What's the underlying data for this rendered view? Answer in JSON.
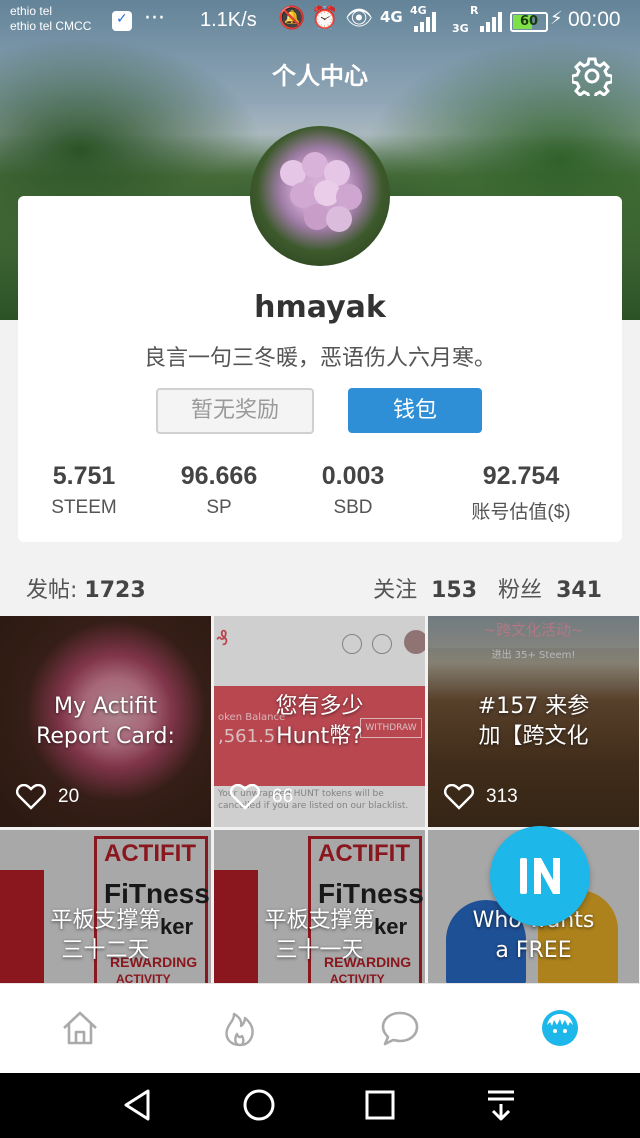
{
  "status_bar": {
    "carrier_line1": "ethio tel",
    "carrier_line2": "ethio tel CMCC",
    "more": "···",
    "speed": "1.1K/s",
    "net_4g": "4G",
    "net_4g_small": "4G",
    "net_r": "R",
    "net_3g": "3G",
    "battery": "60",
    "battery_level": 0.6,
    "time": "00:00"
  },
  "header": {
    "title": "个人中心",
    "settings_icon": "gear-icon"
  },
  "profile": {
    "username": "hmayak",
    "bio": "良言一句三冬暖，恶语伤人六月寒。",
    "reward_button": "暂无奖励",
    "wallet_button": "钱包",
    "stats": [
      {
        "value": "5.751",
        "label": "STEEM"
      },
      {
        "value": "96.666",
        "label": "SP"
      },
      {
        "value": "0.003",
        "label": "SBD"
      },
      {
        "value": "92.754",
        "label": "账号估值($)"
      }
    ]
  },
  "counts": {
    "posts_label": "发帖:",
    "posts_value": "1723",
    "following_label": "关注",
    "following_value": "153",
    "followers_label": "粉丝",
    "followers_value": "341"
  },
  "posts": [
    {
      "title_line1": "My Actifit",
      "title_line2": "Report Card:",
      "likes": "20"
    },
    {
      "title_line1": "您有多少",
      "title_line2": "Hunt幣?",
      "likes": "66"
    },
    {
      "title_line1": "#157 来参",
      "title_line2": "加【跨文化",
      "likes": "313"
    },
    {
      "title_line1": "平板支撑第",
      "title_line2": "三十二天",
      "likes": ""
    },
    {
      "title_line1": "平板支撑第",
      "title_line2": "三十一天",
      "likes": ""
    },
    {
      "title_line1": "Who wants",
      "title_line2": "a FREE",
      "likes": ""
    }
  ],
  "post_images": {
    "tile2_overlay_a": "oken Balance",
    "tile2_overlay_b": ",561.5",
    "tile2_withdraw": "WITHDRAW",
    "tile2_note": "Your unwrapped HUNT tokens will be cancelled if you are listed on our blacklist.",
    "tile3_banner": "~跨文化活动~",
    "tile3_sub": "进出 35+ Steem!",
    "actifit_line1": "ACTIFIT",
    "actifit_line2": "FiTness",
    "actifit_line3": "ker",
    "actifit_line4": "REWARDING",
    "actifit_line5": "ACTIVITY"
  },
  "tabbar": [
    "home-icon",
    "fire-icon",
    "chat-icon",
    "profile-icon"
  ],
  "navbar": [
    "back-icon",
    "home-circle-icon",
    "recents-icon",
    "notification-pull-icon"
  ],
  "colors": {
    "accent": "#2f8fd6",
    "fab": "#1db7ea",
    "tab_active": "#1db7ea"
  }
}
